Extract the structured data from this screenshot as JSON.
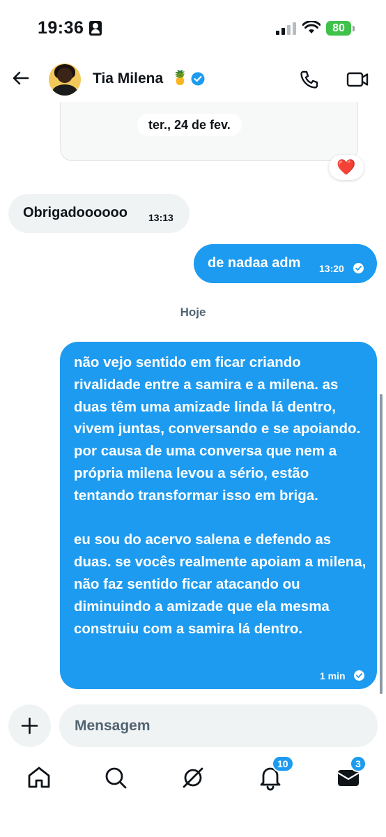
{
  "status_bar": {
    "time": "19:36",
    "battery": "80"
  },
  "header": {
    "contact_name": "Tia Milena",
    "name_emoji": "🍍"
  },
  "shared_card": {
    "date": "ter., 24 de fev.",
    "reaction": "❤️"
  },
  "messages": [
    {
      "direction": "in",
      "text": "Obrigadoooooo",
      "time": "13:13"
    },
    {
      "direction": "out",
      "text": "de nadaa adm",
      "time": "13:20"
    },
    {
      "direction": "out",
      "paragraphs": [
        "não vejo sentido em ficar criando rivalidade entre a samira e a milena. as duas têm uma amizade linda lá dentro, vivem juntas, conversando e se apoiando. por causa de uma conversa que nem a própria milena levou a sério, estão tentando transformar isso em briga.",
        "eu sou do acervo salena e defendo as duas. se vocês realmente apoiam a milena, não faz sentido ficar atacando ou diminuindo a amizade que ela mesma construiu com a samira lá dentro."
      ],
      "time": "1 min"
    }
  ],
  "day_divider": "Hoje",
  "composer": {
    "placeholder": "Mensagem"
  },
  "bottom_nav": {
    "notifications_badge": "10",
    "messages_badge": "3"
  },
  "colors": {
    "accent": "#1d9bf0",
    "bubble_in": "#eff3f4",
    "text": "#0f1419",
    "muted": "#536471",
    "battery": "#3ec24a"
  },
  "icons": [
    "back-arrow-icon",
    "verified-icon",
    "phone-icon",
    "video-icon",
    "check-icon",
    "plus-icon",
    "home-icon",
    "search-icon",
    "grok-icon",
    "bell-icon",
    "envelope-icon"
  ]
}
